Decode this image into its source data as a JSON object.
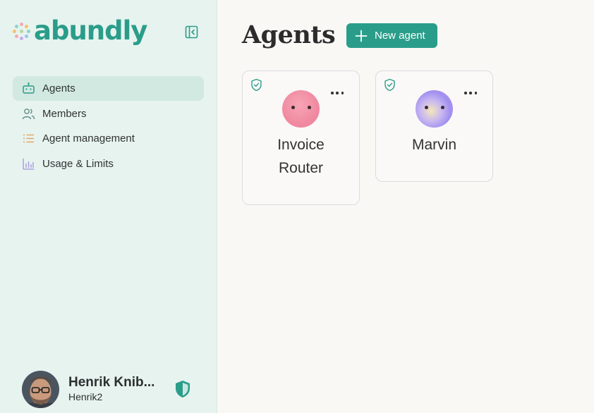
{
  "app": {
    "logo_text": "abundly",
    "brand_color": "#2a9d8a"
  },
  "sidebar": {
    "collapse_icon": "sidebar-collapse-icon",
    "items": [
      {
        "label": "Agents",
        "icon": "robot-icon",
        "active": true
      },
      {
        "label": "Members",
        "icon": "users-icon",
        "active": false
      },
      {
        "label": "Agent management",
        "icon": "list-icon",
        "active": false
      },
      {
        "label": "Usage & Limits",
        "icon": "bar-chart-icon",
        "active": false
      }
    ]
  },
  "user": {
    "name": "Henrik Knib...",
    "handle": "Henrik2",
    "badge_icon": "shield-icon"
  },
  "main": {
    "title": "Agents",
    "new_agent_label": "New agent",
    "agents": [
      {
        "name": "Invoice Router",
        "verified": true,
        "menu_icon": "more-horizontal-icon"
      },
      {
        "name": "Marvin",
        "verified": true,
        "menu_icon": "more-horizontal-icon"
      }
    ]
  }
}
